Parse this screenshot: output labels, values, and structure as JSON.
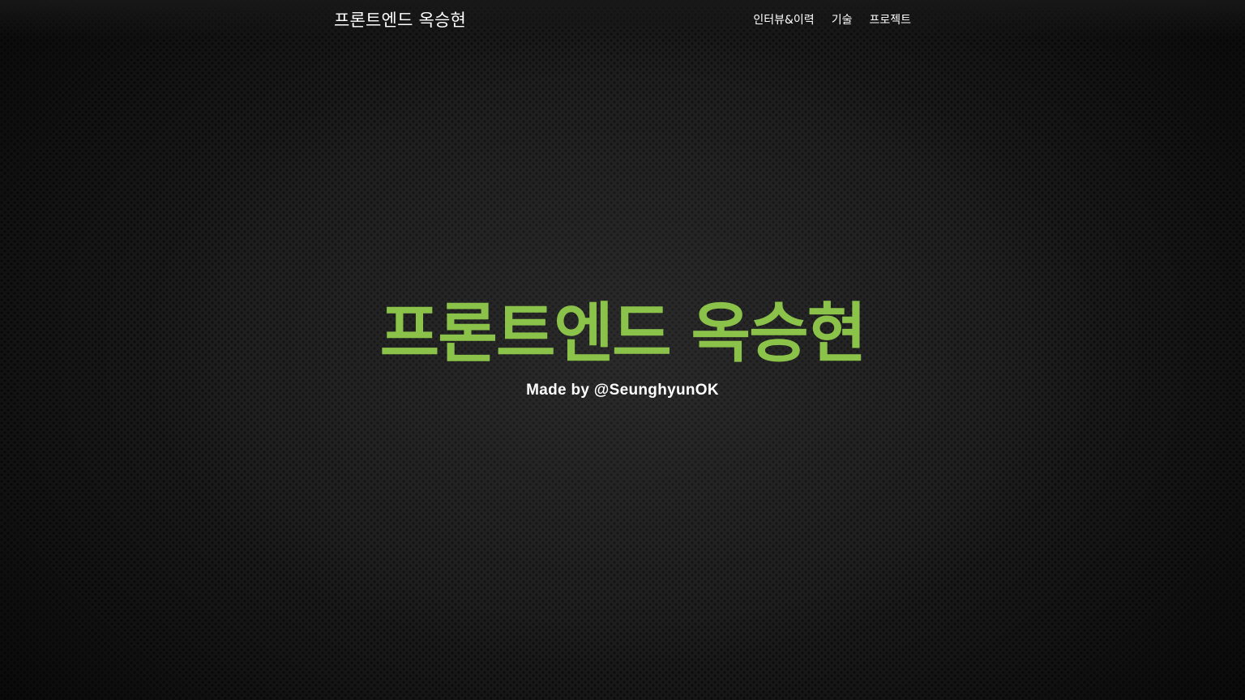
{
  "navbar": {
    "brand": "프론트엔드 옥승현",
    "links": [
      {
        "label": "인터뷰&이력"
      },
      {
        "label": "기술"
      },
      {
        "label": "프로젝트"
      }
    ]
  },
  "hero": {
    "title": "프론트엔드 옥승현",
    "subtitle": "Made by @SeunghyunOK"
  },
  "colors": {
    "accent": "#8bc34a",
    "background": "#1c1c1c",
    "text": "#ffffff"
  }
}
